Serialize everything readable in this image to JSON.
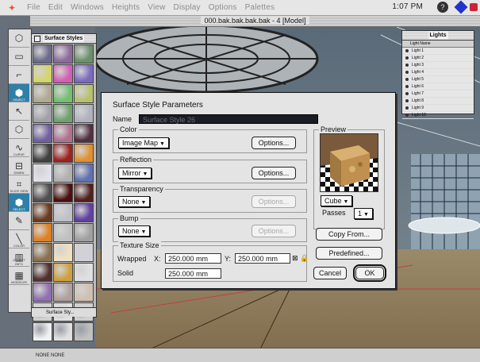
{
  "menubar": {
    "items": [
      "File",
      "Edit",
      "Windows",
      "Heights",
      "View",
      "Display",
      "Options",
      "Palettes"
    ],
    "clock": "1:07 PM"
  },
  "model_window": {
    "title": "000.bak.bak.bak.bak - 4 [Model]"
  },
  "toolbox": {
    "labels": [
      "OBJECT",
      "CURVE",
      "DIMEN",
      "SLICE VIEW",
      "SELECT",
      "COLOR",
      "OBJECT INFO",
      "MODELER"
    ]
  },
  "surface_palette": {
    "title": "Surface Styles",
    "footer": "Surface Sty...",
    "swatches": [
      "#6b6b8a",
      "#8c6a9c",
      "#6a8f6a",
      "#d4d46a",
      "#d060b0",
      "#7a6abf",
      "#b0a890",
      "#70c070",
      "#b8c070",
      "#a0a0a8",
      "#70a070",
      "#b0b0c0",
      "#7060a0",
      "#b07090",
      "#503040",
      "#404040",
      "#a02020",
      "#e09030",
      "#e0e0e8",
      "#b0b0b0",
      "#6070b0",
      "#505050",
      "#4a1010",
      "#502020",
      "#6a3a20",
      "#c0c0c8",
      "#6040a0",
      "#e08020",
      "#c0c0c0",
      "#a0a0a0",
      "#8a7050",
      "#f0e0c0",
      "#d0d0d8",
      "#503030",
      "#d0a040",
      "#e0e0e0",
      "#9070b0",
      "#b0a0a0",
      "#d0c0b0",
      "#d0d0d0",
      "#e0e0e0",
      "#d0d0d0",
      "#f0f0f0",
      "#e0e0e0",
      "#c0c0c0"
    ]
  },
  "lights_palette": {
    "title": "Lights",
    "header": "Light Name",
    "items": [
      "Light 1",
      "Light 2",
      "Light 3",
      "Light 4",
      "Light 5",
      "Light 6",
      "Light 7",
      "Light 8",
      "Light 9",
      "Light 10"
    ]
  },
  "dialog": {
    "title": "Surface Style Parameters",
    "name_label": "Name",
    "name_value": "Surface Style 26",
    "color_group": "Color",
    "color_value": "Image Map",
    "reflection_group": "Reflection",
    "reflection_value": "Mirror",
    "transparency_group": "Transparency",
    "transparency_value": "None",
    "bump_group": "Bump",
    "bump_value": "None",
    "options_label": "Options...",
    "texture_group": "Texture Size",
    "wrapped_label": "Wrapped",
    "x_label": "X:",
    "x_value": "250.000 mm",
    "y_label": "Y:",
    "y_value": "250.000 mm",
    "solid_label": "Solid",
    "solid_value": "250.000 mm",
    "preview_group": "Preview",
    "shape_value": "Cube",
    "passes_label": "Passes",
    "passes_value": "1",
    "copy_from": "Copy From...",
    "predefined": "Predefined...",
    "cancel": "Cancel",
    "ok": "OK"
  },
  "bottom_bar": {
    "text": "NONE  NONE"
  }
}
